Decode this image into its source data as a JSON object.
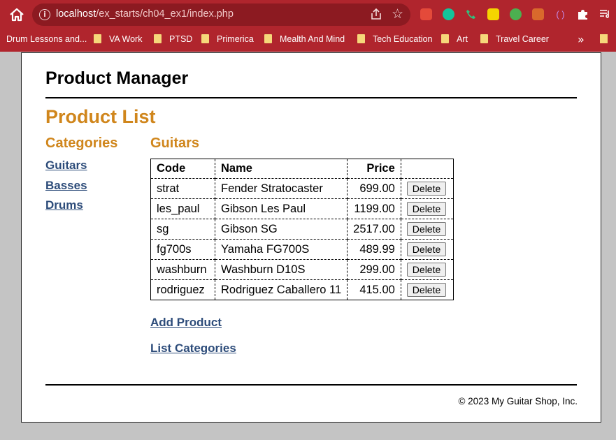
{
  "browser": {
    "url_host": "localhost",
    "url_path": "/ex_starts/ch04_ex1/index.php",
    "bookmarks": [
      {
        "label": "Drum Lessons and..."
      },
      {
        "label": "VA Work"
      },
      {
        "label": "PTSD"
      },
      {
        "label": "Primerica"
      },
      {
        "label": "Mealth And Mind"
      },
      {
        "label": "Tech Education"
      },
      {
        "label": "Art"
      },
      {
        "label": "Travel Career"
      }
    ],
    "bookmark_overflow": "»"
  },
  "page": {
    "header_title": "Product Manager",
    "main_title": "Product List",
    "sidebar": {
      "heading": "Categories",
      "categories": [
        "Guitars",
        "Basses",
        "Drums"
      ]
    },
    "current_category": "Guitars",
    "table": {
      "headers": {
        "code": "Code",
        "name": "Name",
        "price": "Price"
      },
      "rows": [
        {
          "code": "strat",
          "name": "Fender Stratocaster",
          "price": "699.00"
        },
        {
          "code": "les_paul",
          "name": "Gibson Les Paul",
          "price": "1199.00"
        },
        {
          "code": "sg",
          "name": "Gibson SG",
          "price": "2517.00"
        },
        {
          "code": "fg700s",
          "name": "Yamaha FG700S",
          "price": "489.99"
        },
        {
          "code": "washburn",
          "name": "Washburn D10S",
          "price": "299.00"
        },
        {
          "code": "rodriguez",
          "name": "Rodriguez Caballero 11",
          "price": "415.00"
        }
      ],
      "delete_label": "Delete"
    },
    "links": {
      "add_product": "Add Product",
      "list_categories": "List Categories"
    },
    "footer": "© 2023 My Guitar Shop, Inc."
  }
}
